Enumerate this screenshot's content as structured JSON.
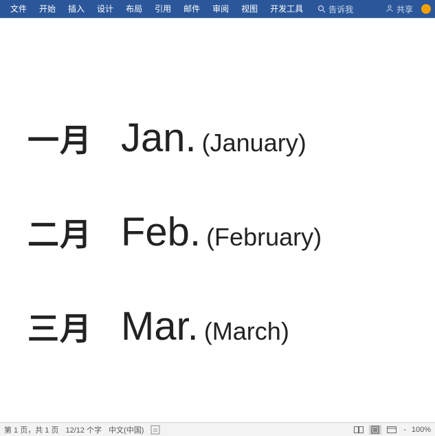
{
  "ribbon": {
    "tabs": [
      "文件",
      "开始",
      "插入",
      "设计",
      "布局",
      "引用",
      "邮件",
      "审阅",
      "视图",
      "开发工具"
    ],
    "tellme_placeholder": "告诉我",
    "share_label": "共享"
  },
  "document": {
    "rows": [
      {
        "cn": "一月",
        "abbr": "Jan.",
        "full": "(January)"
      },
      {
        "cn": "二月",
        "abbr": "Feb.",
        "full": "(February)"
      },
      {
        "cn": "三月",
        "abbr": "Mar.",
        "full": "(March)"
      }
    ]
  },
  "statusbar": {
    "page_label": "第 1 页，共 1 页",
    "word_count": "12/12 个字",
    "language": "中文(中国)",
    "zoom": "100%",
    "dash": "-"
  }
}
